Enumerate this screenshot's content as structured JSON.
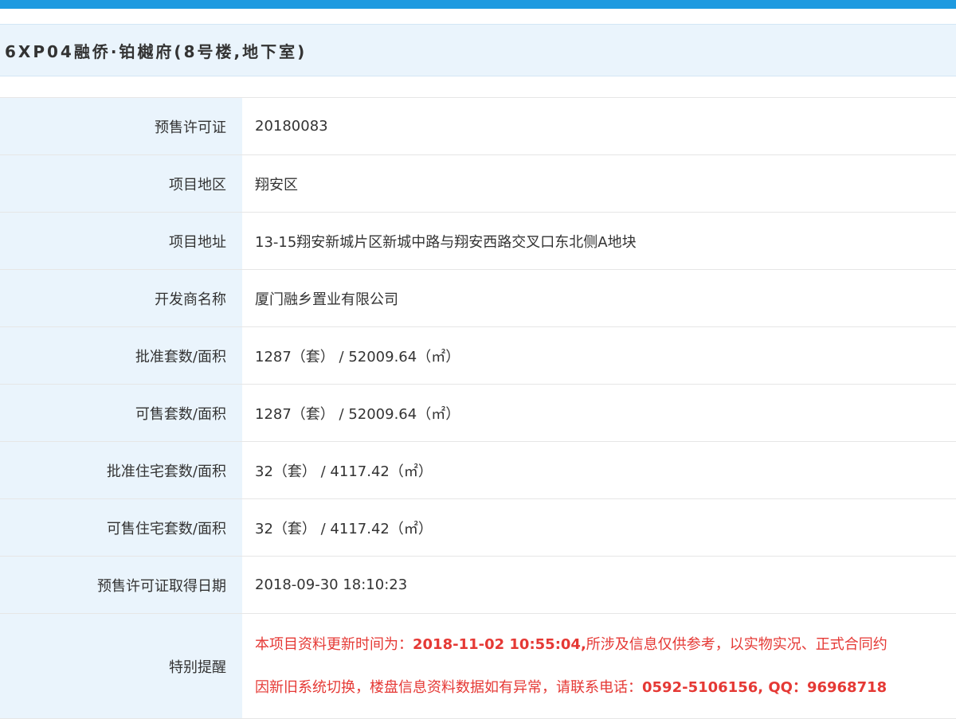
{
  "page": {
    "title": "6XP04融侨·铂樾府(8号楼,地下室)"
  },
  "rows": [
    {
      "label": "预售许可证",
      "value": "20180083"
    },
    {
      "label": "项目地区",
      "value": "翔安区"
    },
    {
      "label": "项目地址",
      "value": "13-15翔安新城片区新城中路与翔安西路交叉口东北侧A地块"
    },
    {
      "label": "开发商名称",
      "value": "厦门融乡置业有限公司"
    },
    {
      "label": "批准套数/面积",
      "value": "1287（套） / 52009.64（㎡）"
    },
    {
      "label": "可售套数/面积",
      "value": "1287（套） / 52009.64（㎡）"
    },
    {
      "label": "批准住宅套数/面积",
      "value": "32（套） / 4117.42（㎡）"
    },
    {
      "label": "可售住宅套数/面积",
      "value": "32（套） / 4117.42（㎡）"
    },
    {
      "label": "预售许可证取得日期",
      "value": "2018-09-30 18:10:23"
    }
  ],
  "notice": {
    "label": "特别提醒",
    "line1_prefix": "本项目资料更新时间为：",
    "line1_time": "2018-11-02 10:55:04,",
    "line1_suffix": "所涉及信息仅供参考，以实物实况、正式合同约",
    "line2_prefix": "因新旧系统切换，楼盘信息资料数据如有异常，请联系电话：",
    "line2_phone": "0592-5106156, QQ：",
    "line2_qq": "96968718"
  },
  "colors": {
    "top_bar": "#1e9ae0",
    "label_bg": "#eaf4fc",
    "notice_text": "#e53935"
  }
}
